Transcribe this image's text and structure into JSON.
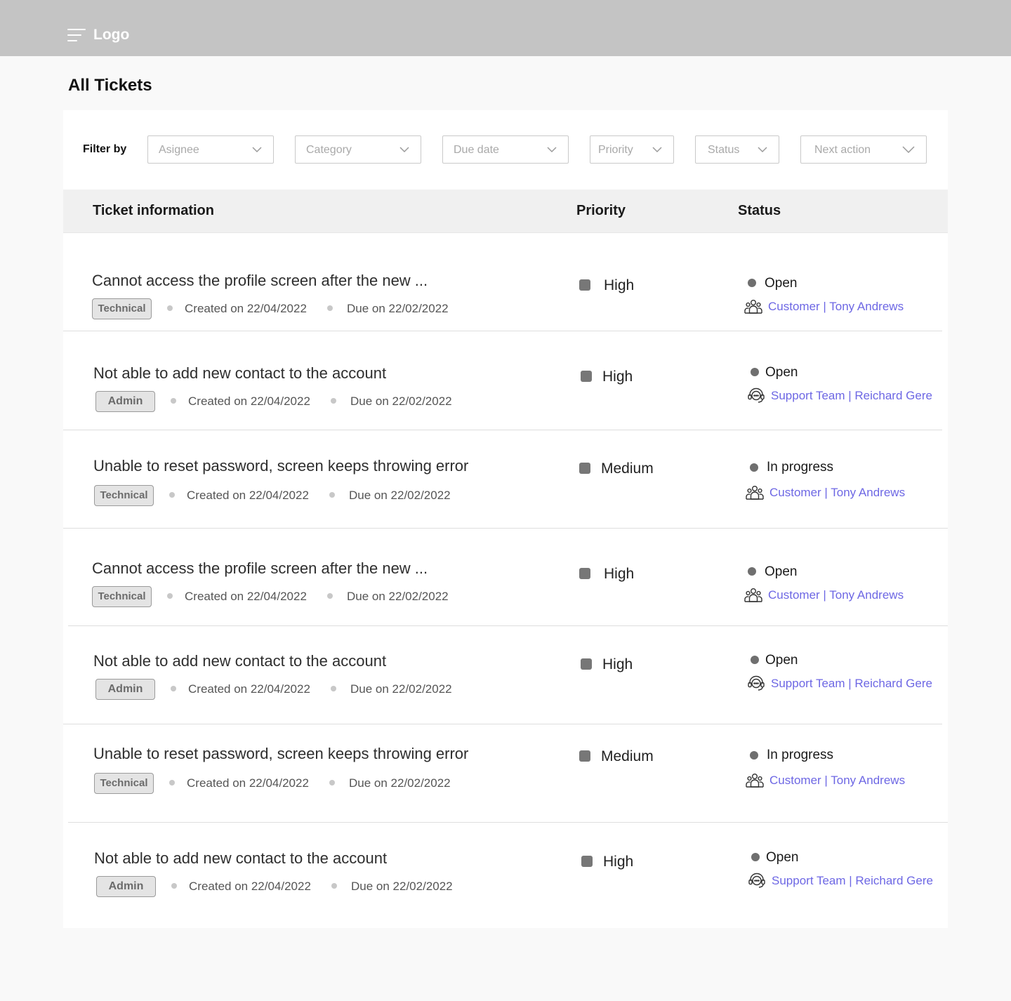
{
  "header": {
    "logo": "Logo",
    "menu_icon": "hamburger-menu-icon"
  },
  "page": {
    "title": "All Tickets"
  },
  "filters": {
    "label": "Filter by",
    "items": [
      {
        "placeholder": "Asignee"
      },
      {
        "placeholder": "Category"
      },
      {
        "placeholder": "Due date"
      },
      {
        "placeholder": "Priority"
      },
      {
        "placeholder": "Status"
      },
      {
        "placeholder": "Next action"
      }
    ]
  },
  "table": {
    "columns": [
      "Ticket information",
      "Priority",
      "Status"
    ],
    "rows": [
      {
        "title": "Cannot access the profile screen after the new ...",
        "category": "Technical",
        "created": "Created on  22/04/2022",
        "due": "Due on 22/02/2022",
        "priority": "High",
        "status": "Open",
        "assignee": "Customer | Tony Andrews",
        "assignee_icon": "people-group-icon"
      },
      {
        "title": "Not able to add new contact to the account",
        "category": "Admin",
        "created": "Created on  22/04/2022",
        "due": "Due on 22/02/2022",
        "priority": "High",
        "status": "Open",
        "assignee": "Support Team | Reichard Gere",
        "assignee_icon": "headset-support-icon"
      },
      {
        "title": "Unable to reset password, screen keeps throwing error",
        "category": "Technical",
        "created": "Created on  22/04/2022",
        "due": "Due on 22/02/2022",
        "priority": "Medium",
        "status": "In progress",
        "assignee": "Customer | Tony Andrews",
        "assignee_icon": "people-group-icon"
      },
      {
        "title": "Cannot access the profile screen after the new ...",
        "category": "Technical",
        "created": "Created on  22/04/2022",
        "due": "Due on 22/02/2022",
        "priority": "High",
        "status": "Open",
        "assignee": "Customer | Tony Andrews",
        "assignee_icon": "people-group-icon"
      },
      {
        "title": "Not able to add new contact to the account",
        "category": "Admin",
        "created": "Created on  22/04/2022",
        "due": "Due on 22/02/2022",
        "priority": "High",
        "status": "Open",
        "assignee": "Support Team | Reichard Gere",
        "assignee_icon": "headset-support-icon"
      },
      {
        "title": "Unable to reset password, screen keeps throwing error",
        "category": "Technical",
        "created": "Created on  22/04/2022",
        "due": "Due on 22/02/2022",
        "priority": "Medium",
        "status": "In progress",
        "assignee": "Customer | Tony Andrews",
        "assignee_icon": "people-group-icon"
      },
      {
        "title": "Not able to add new contact to the account",
        "category": "Admin",
        "created": "Created on  22/04/2022",
        "due": "Due on 22/02/2022",
        "priority": "High",
        "status": "Open",
        "assignee": "Support Team | Reichard Gere",
        "assignee_icon": "headset-support-icon"
      }
    ]
  },
  "colors": {
    "topbar": "#c4c4c4",
    "assignee_link": "#6d67e4",
    "priority_marker": "#777777",
    "status_marker": "#6f6f6f"
  }
}
